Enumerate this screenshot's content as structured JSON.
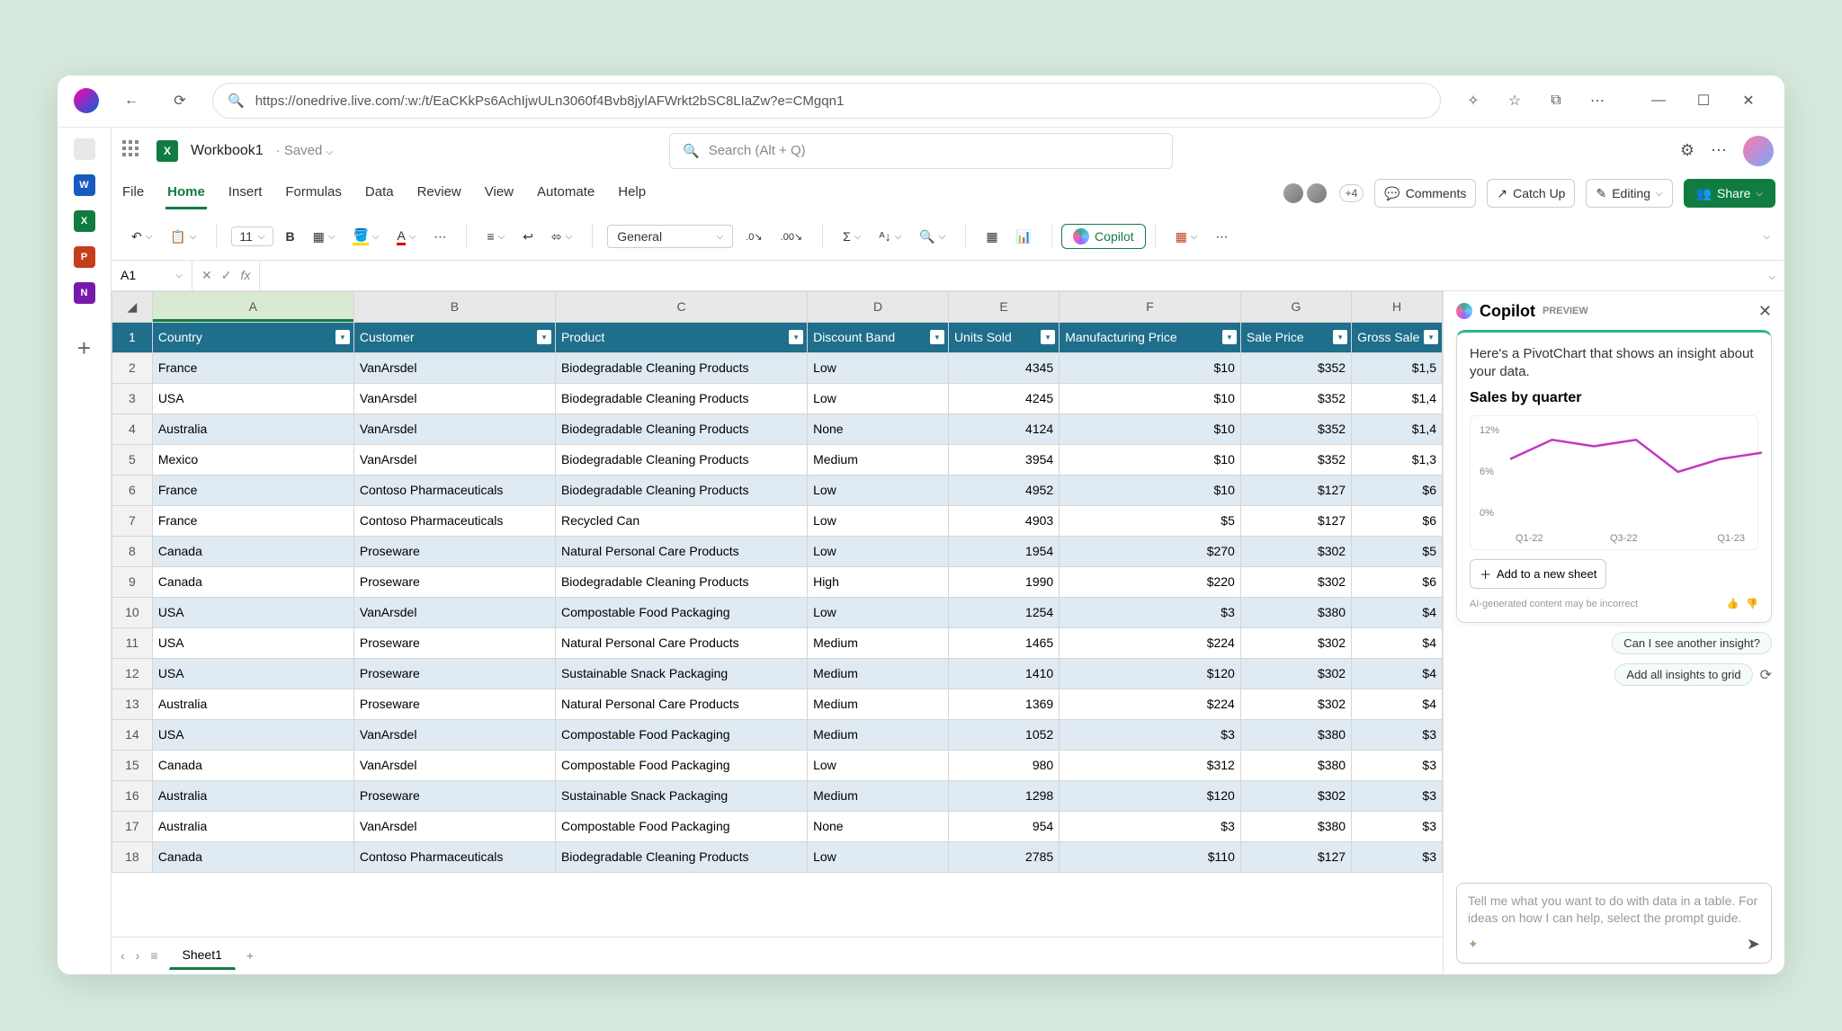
{
  "browser": {
    "url": "https://onedrive.live.com/:w:/t/EaCKkPs6AchIjwULn3060f4Bvb8jylAFWrkt2bSC8LIaZw?e=CMgqn1"
  },
  "sidebar": {
    "items": [
      {
        "label": "Feed",
        "color": "#e8e8e8",
        "text": "",
        "tc": "#555"
      },
      {
        "label": "Word",
        "color": "#185abd",
        "text": "W",
        "tc": "#fff"
      },
      {
        "label": "Excel",
        "color": "#107c41",
        "text": "X",
        "tc": "#fff"
      },
      {
        "label": "PowerPoint",
        "color": "#c43e1c",
        "text": "P",
        "tc": "#fff"
      },
      {
        "label": "OneNote",
        "color": "#7719aa",
        "text": "N",
        "tc": "#fff"
      }
    ]
  },
  "workbook": {
    "name": "Workbook1",
    "status": "Saved"
  },
  "search": {
    "placeholder": "Search (Alt + Q)"
  },
  "tabs": {
    "items": [
      "File",
      "Home",
      "Insert",
      "Formulas",
      "Data",
      "Review",
      "View",
      "Automate",
      "Help"
    ],
    "active": "Home"
  },
  "collab": {
    "extra": "+4",
    "comments": "Comments",
    "catchup": "Catch Up",
    "editing": "Editing",
    "share": "Share"
  },
  "ribbon": {
    "fontsize": "11",
    "numfmt": "General",
    "copilot": "Copilot"
  },
  "namebox": "A1",
  "columns": [
    "A",
    "B",
    "C",
    "D",
    "E",
    "F",
    "G",
    "H"
  ],
  "headers": [
    "Country",
    "Customer",
    "Product",
    "Discount Band",
    "Units Sold",
    "Manufacturing Price",
    "Sale Price",
    "Gross Sale"
  ],
  "rows": [
    [
      "France",
      "VanArsdel",
      "Biodegradable Cleaning Products",
      "Low",
      "4345",
      "$10",
      "$352",
      "$1,5"
    ],
    [
      "USA",
      "VanArsdel",
      "Biodegradable Cleaning Products",
      "Low",
      "4245",
      "$10",
      "$352",
      "$1,4"
    ],
    [
      "Australia",
      "VanArsdel",
      "Biodegradable Cleaning Products",
      "None",
      "4124",
      "$10",
      "$352",
      "$1,4"
    ],
    [
      "Mexico",
      "VanArsdel",
      "Biodegradable Cleaning Products",
      "Medium",
      "3954",
      "$10",
      "$352",
      "$1,3"
    ],
    [
      "France",
      "Contoso Pharmaceuticals",
      "Biodegradable Cleaning Products",
      "Low",
      "4952",
      "$10",
      "$127",
      "$6"
    ],
    [
      "France",
      "Contoso Pharmaceuticals",
      "Recycled Can",
      "Low",
      "4903",
      "$5",
      "$127",
      "$6"
    ],
    [
      "Canada",
      "Proseware",
      "Natural Personal Care Products",
      "Low",
      "1954",
      "$270",
      "$302",
      "$5"
    ],
    [
      "Canada",
      "Proseware",
      "Biodegradable Cleaning Products",
      "High",
      "1990",
      "$220",
      "$302",
      "$6"
    ],
    [
      "USA",
      "VanArsdel",
      "Compostable Food Packaging",
      "Low",
      "1254",
      "$3",
      "$380",
      "$4"
    ],
    [
      "USA",
      "Proseware",
      "Natural Personal Care Products",
      "Medium",
      "1465",
      "$224",
      "$302",
      "$4"
    ],
    [
      "USA",
      "Proseware",
      "Sustainable Snack Packaging",
      "Medium",
      "1410",
      "$120",
      "$302",
      "$4"
    ],
    [
      "Australia",
      "Proseware",
      "Natural Personal Care Products",
      "Medium",
      "1369",
      "$224",
      "$302",
      "$4"
    ],
    [
      "USA",
      "VanArsdel",
      "Compostable Food Packaging",
      "Medium",
      "1052",
      "$3",
      "$380",
      "$3"
    ],
    [
      "Canada",
      "VanArsdel",
      "Compostable Food Packaging",
      "Low",
      "980",
      "$312",
      "$380",
      "$3"
    ],
    [
      "Australia",
      "Proseware",
      "Sustainable Snack Packaging",
      "Medium",
      "1298",
      "$120",
      "$302",
      "$3"
    ],
    [
      "Australia",
      "VanArsdel",
      "Compostable Food Packaging",
      "None",
      "954",
      "$3",
      "$380",
      "$3"
    ],
    [
      "Canada",
      "Contoso Pharmaceuticals",
      "Biodegradable Cleaning Products",
      "Low",
      "2785",
      "$110",
      "$127",
      "$3"
    ]
  ],
  "sheet_tabs": {
    "name": "Sheet1"
  },
  "copilot": {
    "title": "Copilot",
    "badge": "PREVIEW",
    "message": "Here's a PivotChart that shows an insight about your data.",
    "chart_title": "Sales by quarter",
    "add_btn": "Add to a new sheet",
    "ai_note": "AI-generated content may be incorrect",
    "suggest1": "Can I see another insight?",
    "suggest2": "Add all insights to grid",
    "input_placeholder": "Tell me what you want to do with data in a table. For ideas on how I can help, select the prompt guide."
  },
  "chart_data": {
    "type": "line",
    "title": "Sales by quarter",
    "categories": [
      "Q1-22",
      "Q3-22",
      "Q1-23"
    ],
    "y_ticks": [
      "12%",
      "6%",
      "0%"
    ],
    "values": [
      9,
      12,
      11,
      12,
      7,
      9,
      10
    ],
    "ylim": [
      0,
      14
    ]
  }
}
